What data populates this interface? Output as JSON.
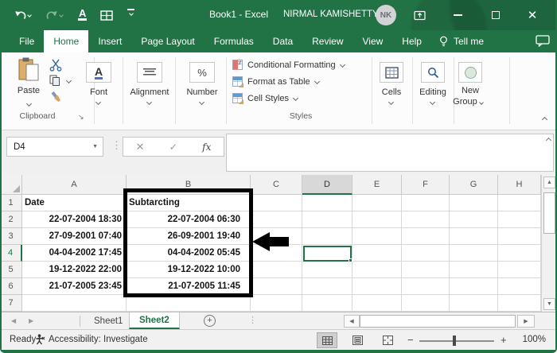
{
  "colors": {
    "excel_green": "#217346",
    "selection_green": "#217346",
    "icon_blue": "#2b579a",
    "annotation_black": "#000000"
  },
  "titlebar": {
    "title": "Book1 - Excel",
    "user_name": "NIRMAL KAMISHETTY",
    "user_initials": "NK"
  },
  "ribbon_tabs": [
    {
      "label": "File",
      "active": false
    },
    {
      "label": "Home",
      "active": true
    },
    {
      "label": "Insert",
      "active": false
    },
    {
      "label": "Page Layout",
      "active": false
    },
    {
      "label": "Formulas",
      "active": false
    },
    {
      "label": "Data",
      "active": false
    },
    {
      "label": "Review",
      "active": false
    },
    {
      "label": "View",
      "active": false
    },
    {
      "label": "Help",
      "active": false
    }
  ],
  "tell_me_label": "Tell me",
  "ribbon": {
    "clipboard": {
      "group_label": "Clipboard",
      "paste_label": "Paste"
    },
    "font": {
      "group_label": "Font"
    },
    "alignment": {
      "group_label": "Alignment"
    },
    "number": {
      "group_label": "Number"
    },
    "styles": {
      "group_label": "Styles",
      "items": [
        "Conditional Formatting",
        "Format as Table",
        "Cell Styles"
      ]
    },
    "cells": {
      "group_label": "Cells"
    },
    "editing": {
      "group_label": "Editing"
    },
    "new_group": {
      "line1": "New",
      "line2": "Group"
    }
  },
  "formula_bar": {
    "name_box_value": "D4",
    "fx_label": "fx"
  },
  "grid": {
    "columns": [
      "A",
      "B",
      "C",
      "D",
      "E",
      "F",
      "G",
      "H"
    ],
    "selected": {
      "cell": "D4",
      "column": "D",
      "row": 4
    },
    "rows": [
      {
        "n": 1,
        "A": "Date",
        "B": "Subtarcting"
      },
      {
        "n": 2,
        "A": "22-07-2004 18:30",
        "B": "22-07-2004 06:30"
      },
      {
        "n": 3,
        "A": "27-09-2001 07:40",
        "B": "26-09-2001 19:40"
      },
      {
        "n": 4,
        "A": "04-04-2002 17:45",
        "B": "04-04-2002 05:45"
      },
      {
        "n": 5,
        "A": "19-12-2022 22:00",
        "B": "19-12-2022 10:00"
      },
      {
        "n": 6,
        "A": "21-07-2005 23:45",
        "B": "21-07-2005 11:45"
      },
      {
        "n": 7,
        "A": "",
        "B": ""
      }
    ]
  },
  "sheet_tabs": [
    {
      "label": "Sheet1",
      "active": false
    },
    {
      "label": "Sheet2",
      "active": true
    }
  ],
  "status_bar": {
    "ready_label": "Ready",
    "accessibility_label": "Accessibility: Investigate",
    "zoom_value": "100%"
  }
}
